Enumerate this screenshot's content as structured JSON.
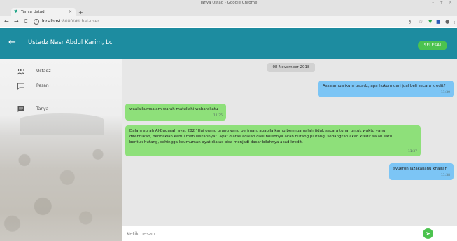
{
  "window": {
    "title": "Tanya Ustad - Google Chrome",
    "controls": "– + ×"
  },
  "tab": {
    "title": "Tanya Ustad",
    "close": "×",
    "new": "+"
  },
  "omnibar": {
    "host": "localhost",
    "path": ":8080/#/chat-user"
  },
  "appbar": {
    "title": "Ustadz Nasr Abdul Karim, Lc",
    "done_label": "SELESAI"
  },
  "sidebar": {
    "items": [
      {
        "label": "Ustadz",
        "icon": "people-icon"
      },
      {
        "label": "Pesan",
        "icon": "message-outline-icon"
      },
      {
        "label": "Tanya",
        "icon": "chat-filled-icon"
      }
    ]
  },
  "chat": {
    "date": "08 November 2018",
    "messages": [
      {
        "side": "out",
        "text": "Assalamualikum ustadz, apa hukum dari jual beli secara kredit?",
        "time": "11:30"
      },
      {
        "side": "in",
        "text": "waalaikumsalam warah matullahi wabarakatu",
        "time": "11:35"
      },
      {
        "side": "in",
        "text": "Dalam surah Al-Baqarah ayat 282 \"Hai orang orang yang beriman, apabila kamu bermuamalah tidak secara tunai untuk waktu yang ditentukan, hendaklah kamu menuliskannya\". Ayat diatas adalah dalil bolehnya akan hutang piutang, sedangkan akan kredit salah satu bentuk hutang, sehingga keumuman ayat diatas bisa menjadi dasar bilahnya akad kredit.",
        "time": "11:37"
      },
      {
        "side": "out",
        "text": "syukron jazakallahu khairan",
        "time": "11:38"
      }
    ]
  },
  "composer": {
    "placeholder": "Ketik pesan ..."
  }
}
